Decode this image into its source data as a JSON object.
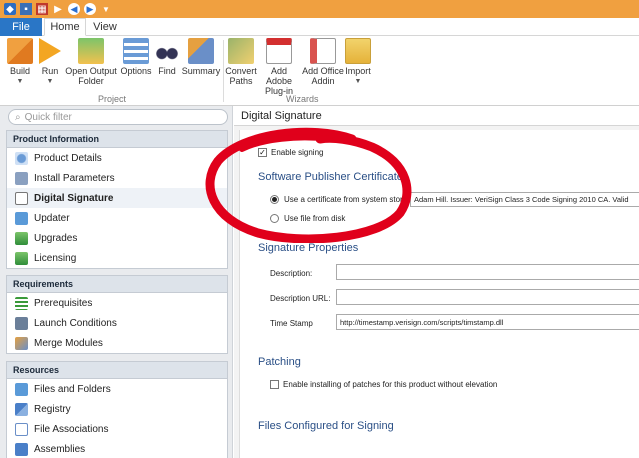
{
  "titlebar": {
    "icons": [
      "app-icon",
      "save-icon",
      "build-grid-icon",
      "run-icon",
      "back-icon",
      "forward-icon",
      "customize-icon"
    ]
  },
  "tabs": {
    "file": "File",
    "home": "Home",
    "view": "View"
  },
  "ribbon": {
    "build": "Build",
    "run": "Run",
    "open_output_1": "Open Output",
    "open_output_2": "Folder",
    "options": "Options",
    "find": "Find",
    "summary": "Summary",
    "group_project": "Project",
    "convert_1": "Convert",
    "convert_2": "Paths",
    "add_adobe_1": "Add Adobe",
    "add_adobe_2": "Plug-in",
    "add_office_1": "Add Office",
    "add_office_2": "Addin",
    "import": "Import",
    "group_wizards": "Wizards"
  },
  "sidebar": {
    "filter_placeholder": "Quick filter",
    "product_info": {
      "title": "Product Information",
      "items": [
        "Product Details",
        "Install Parameters",
        "Digital Signature",
        "Updater",
        "Upgrades",
        "Licensing"
      ]
    },
    "requirements": {
      "title": "Requirements",
      "items": [
        "Prerequisites",
        "Launch Conditions",
        "Merge Modules"
      ]
    },
    "resources": {
      "title": "Resources",
      "items": [
        "Files and Folders",
        "Registry",
        "File Associations",
        "Assemblies"
      ]
    }
  },
  "main": {
    "title": "Digital Signature",
    "enable_signing": "Enable signing",
    "spc_heading": "Software Publisher Certificate",
    "use_cert_store": "Use a certificate from system store",
    "cert_value": "Adam Hill. Issuer: VeriSign Class 3 Code Signing 2010 CA. Valid",
    "use_file": "Use file from disk",
    "sigprops_heading": "Signature Properties",
    "description_label": "Description:",
    "description_value": "",
    "desc_url_label": "Description URL:",
    "desc_url_value": "",
    "timestamp_label": "Time Stamp",
    "timestamp_value": "http://timestamp.verisign.com/scripts/timstamp.dll",
    "patching_heading": "Patching",
    "patching_checkbox": "Enable installing of patches for this product without elevation",
    "files_heading": "Files Configured for Signing"
  },
  "colors": {
    "title_bar": "#f0a040",
    "file_tab": "#2a76c6",
    "heading": "#2a4f86",
    "annotation": "#e0001b"
  }
}
